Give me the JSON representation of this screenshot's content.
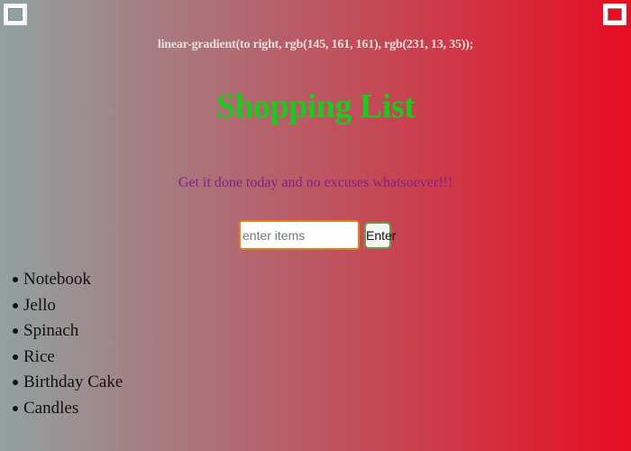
{
  "colors": {
    "gradient_start": "#91a1a1",
    "gradient_end": "#e70d23",
    "title": "#1ec81e",
    "subtitle": "#82228a",
    "input_border": "#e0821c",
    "button_border": "#6a9a4a"
  },
  "color_pickers": {
    "left_value": "#91a1a1",
    "right_value": "#e70d23"
  },
  "gradient_css": "linear-gradient(to right, rgb(145, 161, 161), rgb(231, 13, 35));",
  "header": {
    "title": "Shopping List",
    "subtitle": "Get it done today and no excuses whatsoever!!!"
  },
  "entry": {
    "input_value": "",
    "input_placeholder": "enter items",
    "button_label": "Enter"
  },
  "list": {
    "items": [
      {
        "label": "Notebook"
      },
      {
        "label": "Jello"
      },
      {
        "label": "Spinach"
      },
      {
        "label": "Rice"
      },
      {
        "label": "Birthday Cake"
      },
      {
        "label": "Candles"
      }
    ]
  }
}
